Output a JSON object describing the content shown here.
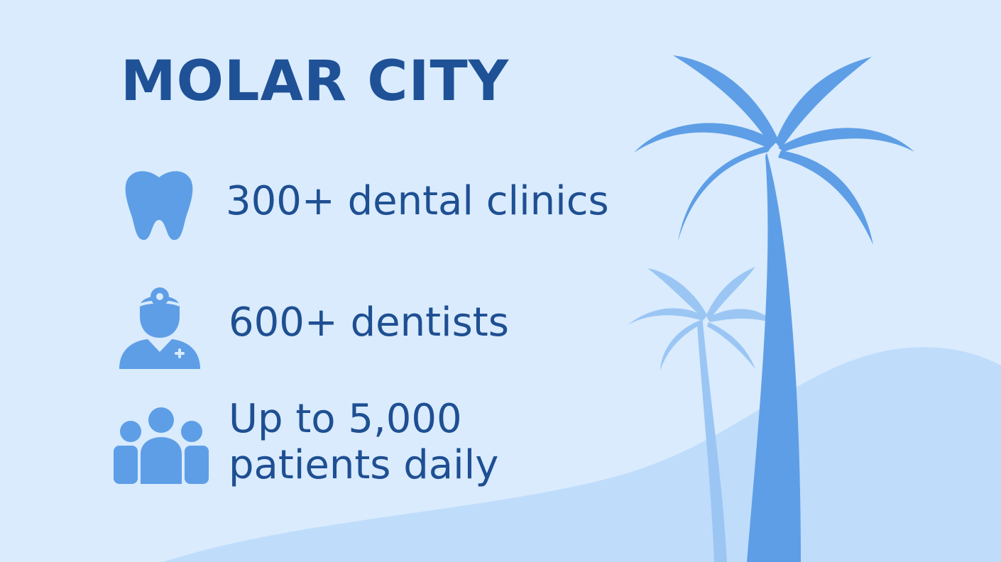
{
  "title": "MOLAR CITY",
  "colors": {
    "background": "#d9ebfd",
    "title_text": "#1f5196",
    "stat_text": "#1f4f92",
    "icon": "#5e9ee6",
    "palm_main": "#5e9ee6",
    "palm_back": "#9bc6f4",
    "hill": "#bfdcfb"
  },
  "stats": [
    {
      "icon": "tooth-icon",
      "lines": [
        "300+ dental clinics"
      ]
    },
    {
      "icon": "dentist-icon",
      "lines": [
        "600+ dentists"
      ]
    },
    {
      "icon": "people-group-icon",
      "lines": [
        "Up to 5,000",
        "patients daily"
      ]
    }
  ],
  "decorations": [
    "large-palm-tree",
    "small-palm-tree",
    "hill"
  ]
}
